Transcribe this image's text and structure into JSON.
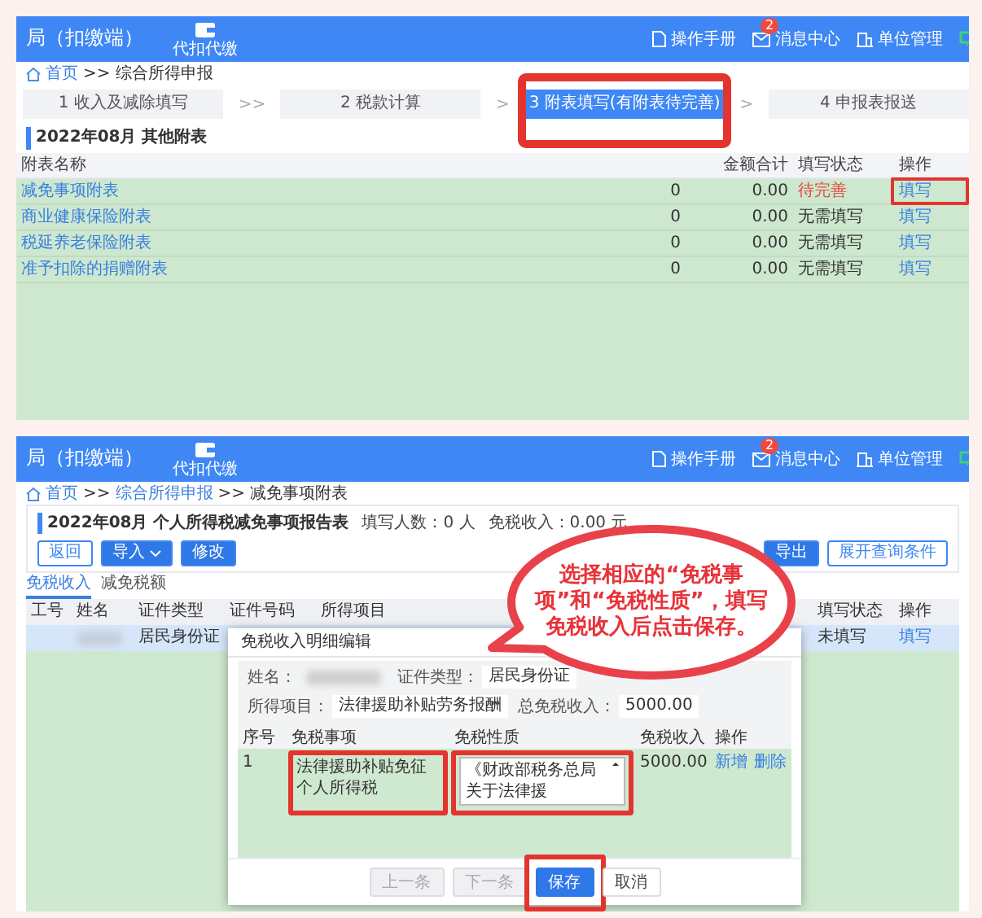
{
  "top_screen": {
    "header": {
      "title": "局（扣缴端）",
      "module": "代扣代缴",
      "links": [
        {
          "kind": "manual",
          "label": "操作手册"
        },
        {
          "kind": "messages",
          "label": "消息中心",
          "badge": "2"
        },
        {
          "kind": "org",
          "label": "单位管理"
        }
      ]
    },
    "breadcrumb": [
      {
        "kind": "link",
        "label": "首页"
      },
      {
        "kind": "separator",
        "label": ">>"
      },
      {
        "kind": "current",
        "label": "综合所得申报"
      }
    ],
    "steps": [
      {
        "kind": "step",
        "label": "1 收入及减除填写",
        "selected": false,
        "highlighted": false
      },
      {
        "kind": "separator",
        "label": ">>"
      },
      {
        "kind": "step",
        "label": "2 税款计算",
        "selected": false,
        "highlighted": false
      },
      {
        "kind": "separator",
        "label": ">"
      },
      {
        "kind": "step",
        "label": "3 附表填写",
        "note": "(有附表待完善)",
        "selected": true,
        "highlighted": true
      },
      {
        "kind": "separator",
        "label": ">"
      },
      {
        "kind": "step",
        "label": "4 申报表报送",
        "selected": false,
        "highlighted": false
      }
    ],
    "title": "2022年08月  其他附表",
    "table": {
      "columns": [
        "附表名称",
        "金额合计",
        "填写状态",
        "操作"
      ],
      "rows": [
        {
          "name": "减免事项附表",
          "column_2": "0",
          "total": "0.00",
          "status": "待完善",
          "pending": true,
          "action": "填写",
          "highlighted": true
        },
        {
          "name": "商业健康保险附表",
          "column_2": "0",
          "total": "0.00",
          "status": "无需填写",
          "pending": false,
          "action": "填写",
          "highlighted": false
        },
        {
          "name": "税延养老保险附表",
          "column_2": "0",
          "total": "0.00",
          "status": "无需填写",
          "pending": false,
          "action": "填写",
          "highlighted": false
        },
        {
          "name": "准予扣除的捐赠附表",
          "column_2": "0",
          "total": "0.00",
          "status": "无需填写",
          "pending": false,
          "action": "填写",
          "highlighted": false
        }
      ]
    }
  },
  "bottom_screen": {
    "header": {
      "title": "局（扣缴端）",
      "module": "代扣代缴",
      "links": [
        {
          "kind": "manual",
          "label": "操作手册"
        },
        {
          "kind": "messages",
          "label": "消息中心",
          "badge": "2"
        },
        {
          "kind": "org",
          "label": "单位管理"
        }
      ]
    },
    "breadcrumb": [
      {
        "kind": "link",
        "label": "首页"
      },
      {
        "kind": "separator",
        "label": ">>"
      },
      {
        "kind": "link",
        "label": "综合所得申报"
      },
      {
        "kind": "separator",
        "label": ">>"
      },
      {
        "kind": "current",
        "label": "减免事项附表"
      }
    ],
    "title": "2022年08月  个人所得税减免事项报告表",
    "stats": [
      "填写人数：0 人",
      "免税收入：0.00 元"
    ],
    "buttons_left": [
      {
        "kind": "outline",
        "label": "返回"
      },
      {
        "kind": "dropdown",
        "label": "导入"
      },
      {
        "kind": "primary",
        "label": "修改"
      }
    ],
    "buttons_right": [
      {
        "kind": "primary",
        "label": "导出"
      },
      {
        "kind": "outline",
        "label": "展开查询条件"
      }
    ],
    "tabs": [
      {
        "label": "免税收入",
        "selected": true
      },
      {
        "label": "减免税额",
        "selected": false
      }
    ],
    "table": {
      "columns": [
        "工号",
        "姓名",
        "证件类型",
        "证件号码",
        "所得项目",
        "填写状态",
        "操作"
      ],
      "rows": [
        {
          "id_type": "居民身份证",
          "status": "未填写",
          "action": "填写",
          "selected": true
        }
      ]
    },
    "dialog": {
      "title": "免税收入明细编辑",
      "fields": [
        [
          {
            "kind": "blurred",
            "label": "姓名："
          },
          {
            "kind": "text",
            "label": "证件类型：",
            "value": "居民身份证"
          }
        ],
        [
          {
            "kind": "text",
            "label": "所得项目：",
            "value": "法律援助补贴劳务报酬"
          },
          {
            "kind": "text",
            "label": "总免税收入：",
            "value": "5000.00"
          }
        ]
      ],
      "table": {
        "columns": [
          "序号",
          "免税事项",
          "免税性质",
          "免税收入",
          "操作"
        ],
        "rows": [
          {
            "index": "1",
            "item": "法律援助补贴免征个人所得税",
            "item_highlighted": true,
            "nature": "《财政部税务总局关于法律援",
            "nature_highlighted": true,
            "income": "5000.00",
            "actions": [
              "新增",
              "删除"
            ]
          }
        ]
      },
      "buttons": [
        {
          "kind": "default",
          "label": "上一条",
          "disabled": true,
          "highlighted": false
        },
        {
          "kind": "default",
          "label": "下一条",
          "disabled": true,
          "highlighted": false
        },
        {
          "kind": "primary",
          "label": "保存",
          "disabled": false,
          "highlighted": true
        },
        {
          "kind": "default",
          "label": "取消",
          "disabled": false,
          "highlighted": false
        }
      ]
    }
  },
  "callout": {
    "text": "选择相应的“免税事项”和“免税性质”，填写免税收入后点击保存。"
  }
}
